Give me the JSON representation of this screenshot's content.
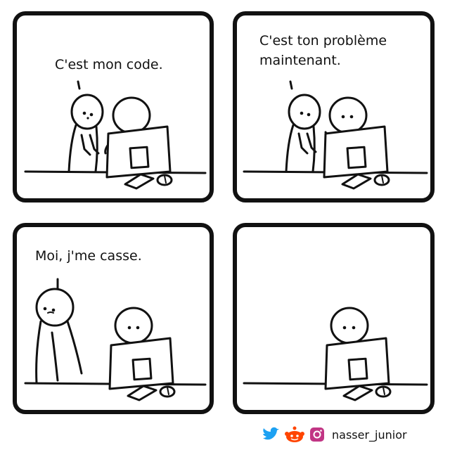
{
  "panels": [
    {
      "speech": "C'est mon code."
    },
    {
      "speech": "C'est ton problème\nmaintenant."
    },
    {
      "speech": "Moi, j'me casse."
    },
    {
      "speech": ""
    }
  ],
  "credits": {
    "handle": "nasser_junior",
    "icons": [
      "twitter-icon",
      "reddit-icon",
      "instagram-icon"
    ],
    "colors": {
      "twitter": "#1da1f2",
      "reddit": "#ff4500",
      "instagram": "#c13584"
    }
  }
}
